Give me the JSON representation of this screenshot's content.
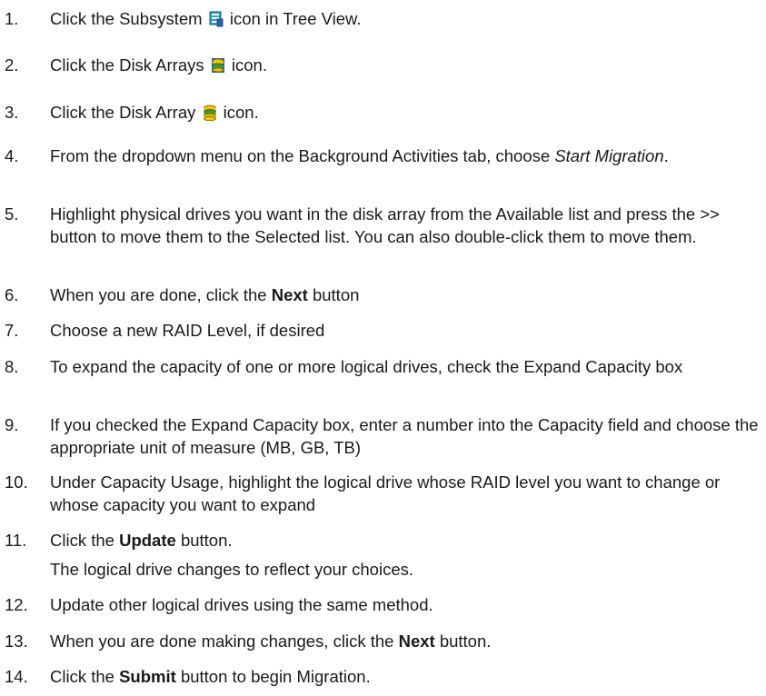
{
  "steps": [
    {
      "num": "1.",
      "before": "Click the Subsystem",
      "icon": "subsystem-icon",
      "after": "icon in Tree View."
    },
    {
      "num": "2.",
      "before": "Click the Disk Arrays",
      "icon": "disk-arrays-icon",
      "after": "icon."
    },
    {
      "num": "3.",
      "before": "Click the Disk Array",
      "icon": "disk-array-icon",
      "after": "icon."
    },
    {
      "num": "4.",
      "before": "From the dropdown menu on the Background Activities tab, choose",
      "italic": "Start Migration",
      "after": "."
    },
    {
      "num": "5.",
      "text": "Highlight physical drives you want in the disk array from the Available list and press the >> button to move them to the Selected list. You can also double-click them to move them."
    },
    {
      "num": "6.",
      "before": "When you are done, click the",
      "bold": "Next",
      "after": "button"
    },
    {
      "num": "7.",
      "text": "Choose a new RAID Level, if desired"
    },
    {
      "num": "8.",
      "text": "To expand the capacity of one or more logical drives, check the Expand Capacity box"
    },
    {
      "num": "9.",
      "text": "If you checked the Expand Capacity box, enter a number into the Capacity field and choose the appropriate unit of measure (MB, GB, TB)"
    },
    {
      "num": "10.",
      "text": "Under Capacity Usage, highlight the logical drive whose RAID level you want to change or whose capacity you want to expand"
    },
    {
      "num": "11.",
      "before": "Click the",
      "bold": "Update",
      "after": "button.",
      "note": "The logical drive changes to reflect your choices."
    },
    {
      "num": "12.",
      "text": "Update other logical drives using the same method."
    },
    {
      "num": "13.",
      "before": "When you are done making changes, click the",
      "bold": "Next",
      "after": "button."
    },
    {
      "num": "14.",
      "before": "Click the",
      "bold": "Submit",
      "after": "button to begin Migration."
    }
  ],
  "colors": {
    "text": "#1a1a1a",
    "icon_teal": "#2aa6b8",
    "icon_blue": "#2f5fb0",
    "icon_yellow": "#f2c400",
    "icon_green": "#3f9b3a"
  }
}
